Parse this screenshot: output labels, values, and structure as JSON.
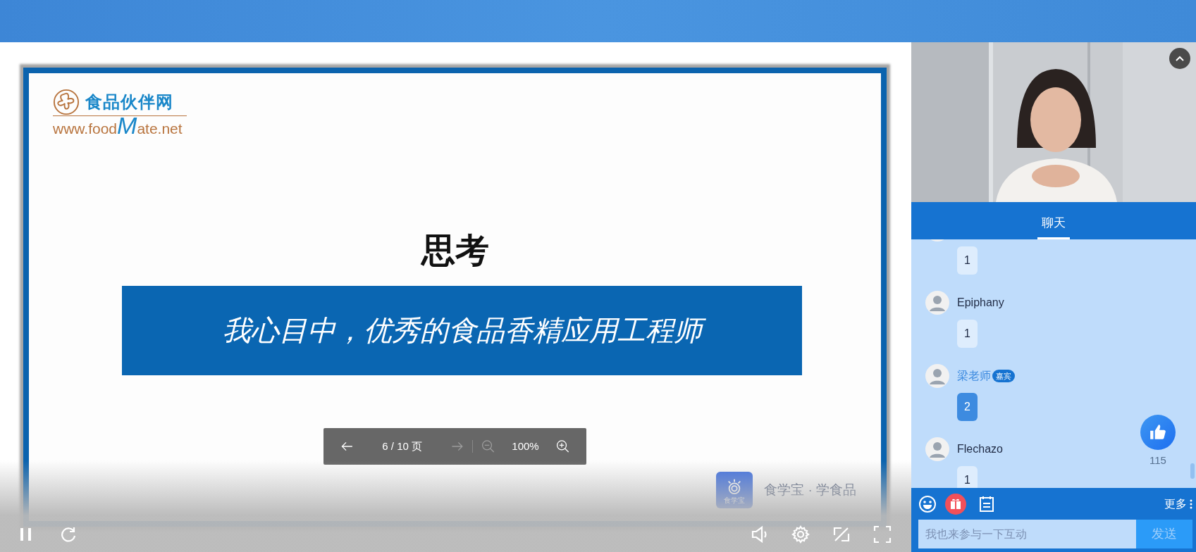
{
  "slide": {
    "logo_name": "食品伙伴网",
    "logo_url": {
      "before": "www.food",
      "highlight": "M",
      "after": "ate.net"
    },
    "title": "思考",
    "banner": "我心目中，优秀的食品香精应用工程师"
  },
  "pager": {
    "page": "6 / 10 页",
    "zoom": "100%",
    "prev_disabled": false,
    "next_disabled": true,
    "zoom_out_disabled": true,
    "zoom_in_disabled": false
  },
  "brand": {
    "icon_caption": "食学宝",
    "text": "食学宝 · 学食品"
  },
  "player": {
    "playing": true
  },
  "chat": {
    "tabs": [
      {
        "label": "聊天",
        "selected": true
      }
    ],
    "messages": [
      {
        "text": "1",
        "kind": "viewer"
      },
      {
        "name": "Epiphany",
        "text": "1",
        "kind": "viewer"
      },
      {
        "name": "梁老师",
        "badge": "嘉宾",
        "text": "2",
        "kind": "guest"
      },
      {
        "name": "Flechazo",
        "text": "1",
        "kind": "viewer"
      }
    ],
    "likes": "115",
    "more": "更多",
    "input": {
      "placeholder": "我也来参与一下互动"
    },
    "send": "发送"
  }
}
